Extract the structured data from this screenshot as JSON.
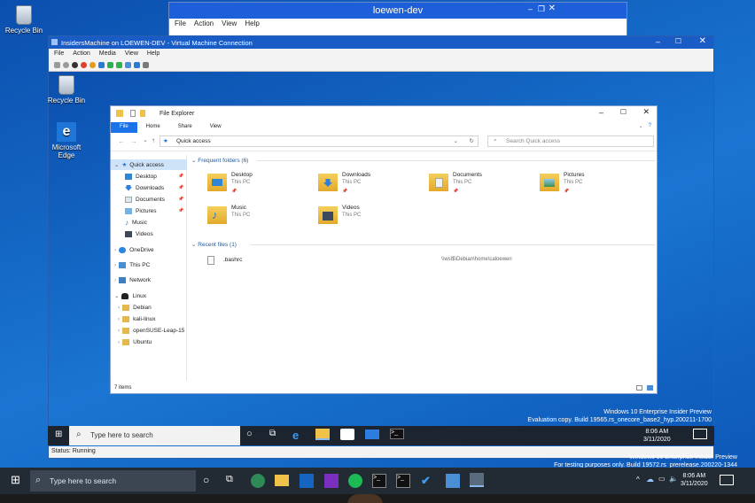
{
  "host_desktop": {
    "recycle_bin_label": "Recycle Bin",
    "watermark_line1": "Windows 10 Enterprise Insider Preview",
    "watermark_line2": "For testing purposes only. Build 19572.rs_prerelease.200220-1344"
  },
  "top_window": {
    "title": "loewen-dev",
    "menu": [
      "File",
      "Action",
      "View",
      "Help"
    ]
  },
  "vm_window": {
    "title": "InsidersMachine on LOEWEN-DEV - Virtual Machine Connection",
    "menu": [
      "File",
      "Action",
      "Media",
      "View",
      "Help"
    ],
    "status": "Status: Running"
  },
  "guest_desktop": {
    "recycle_bin_label": "Recycle Bin",
    "edge_label": "Microsoft Edge",
    "watermark_line1": "Windows 10 Enterprise Insider Preview",
    "watermark_line2": "Evaluation copy. Build 19565.rs_onecore_base2_hyp.200211-1700"
  },
  "file_explorer": {
    "title": "File Explorer",
    "tabs": [
      "File",
      "Home",
      "Share",
      "View"
    ],
    "address": "Quick access",
    "search_placeholder": "Search Quick access",
    "nav": [
      {
        "label": "Quick access"
      },
      {
        "label": "Desktop"
      },
      {
        "label": "Downloads"
      },
      {
        "label": "Documents"
      },
      {
        "label": "Pictures"
      },
      {
        "label": "Music"
      },
      {
        "label": "Videos"
      },
      {
        "label": "OneDrive"
      },
      {
        "label": "This PC"
      },
      {
        "label": "Network"
      },
      {
        "label": "Linux"
      },
      {
        "label": "Debian"
      },
      {
        "label": "kali-linux"
      },
      {
        "label": "openSUSE-Leap-15"
      },
      {
        "label": "Ubuntu"
      }
    ],
    "frequent_header": "Frequent folders (6)",
    "folders": [
      {
        "name": "Desktop",
        "sub": "This PC"
      },
      {
        "name": "Downloads",
        "sub": "This PC"
      },
      {
        "name": "Documents",
        "sub": "This PC"
      },
      {
        "name": "Pictures",
        "sub": "This PC"
      },
      {
        "name": "Music",
        "sub": "This PC"
      },
      {
        "name": "Videos",
        "sub": "This PC"
      }
    ],
    "recent_header": "Recent files (1)",
    "recent_files": [
      {
        "name": ".bashrc",
        "path": "\\\\wsl$\\Debian\\home\\caloewen"
      }
    ],
    "status": "7 items"
  },
  "guest_taskbar": {
    "search_placeholder": "Type here to search",
    "time": "8:06 AM",
    "date": "3/11/2020"
  },
  "host_taskbar": {
    "search_placeholder": "Type here to search",
    "time": "8:06 AM",
    "date": "3/11/2020"
  }
}
